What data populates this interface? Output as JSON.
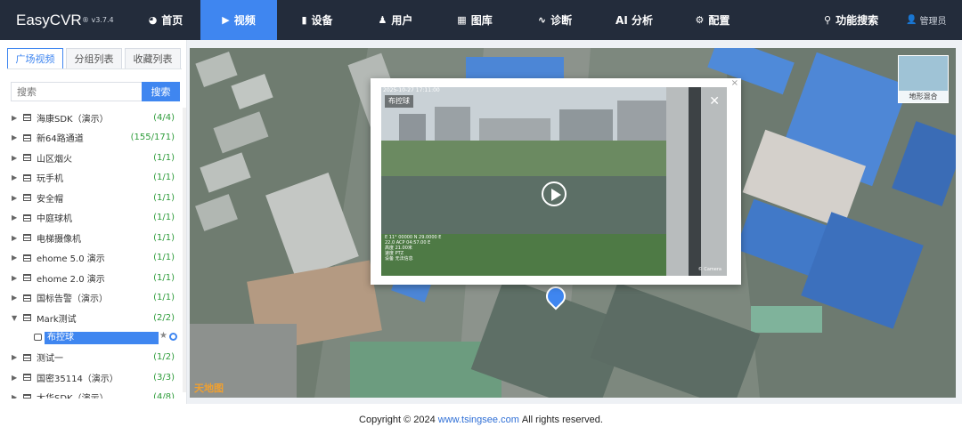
{
  "app": {
    "brand": "EasyCVR",
    "version": "v3.7.4"
  },
  "nav": {
    "items": [
      {
        "label": "首页",
        "icon": "dashboard-icon"
      },
      {
        "label": "视频",
        "icon": "play-circle-icon",
        "active": true
      },
      {
        "label": "设备",
        "icon": "device-icon"
      },
      {
        "label": "用户",
        "icon": "user-add-icon"
      },
      {
        "label": "图库",
        "icon": "gallery-icon"
      },
      {
        "label": "诊断",
        "icon": "pulse-icon"
      },
      {
        "label": "AI 分析",
        "icon": ""
      },
      {
        "label": "配置",
        "icon": "gear-icon"
      }
    ],
    "feature_search": "功能搜索",
    "user": "管理员"
  },
  "sidebar": {
    "tabs": [
      "广场视频",
      "分组列表",
      "收藏列表"
    ],
    "search_placeholder": "搜索",
    "search_button": "搜索",
    "tree": [
      {
        "label": "海康SDK（演示）",
        "count": "(4/4)",
        "expanded": false
      },
      {
        "label": "新64路通道",
        "count": "(155/171)",
        "expanded": false
      },
      {
        "label": "山区烟火",
        "count": "(1/1)",
        "expanded": false
      },
      {
        "label": "玩手机",
        "count": "(1/1)",
        "expanded": false
      },
      {
        "label": "安全帽",
        "count": "(1/1)",
        "expanded": false
      },
      {
        "label": "中庭球机",
        "count": "(1/1)",
        "expanded": false
      },
      {
        "label": "电梯摄像机",
        "count": "(1/1)",
        "expanded": false
      },
      {
        "label": "ehome 5.0 演示",
        "count": "(1/1)",
        "expanded": false
      },
      {
        "label": "ehome 2.0 演示",
        "count": "(1/1)",
        "expanded": false
      },
      {
        "label": "国标告警（演示）",
        "count": "(1/1)",
        "expanded": false
      },
      {
        "label": "Mark测试",
        "count": "(2/2)",
        "expanded": true
      },
      {
        "label": "测试一",
        "count": "(1/2)",
        "expanded": false
      },
      {
        "label": "国密35114（演示）",
        "count": "(3/3)",
        "expanded": false
      },
      {
        "label": "大华SDK（演示）",
        "count": "(4/8)",
        "expanded": false
      }
    ],
    "selected_child": "布控球"
  },
  "map": {
    "layer_label": "地形混合",
    "watermark": "天地图",
    "popup": {
      "timestamp": "2025-10-27 17:11:00",
      "channel_name": "布控球",
      "overlay_lines": [
        "E 11° 00000 N 29.0000 E",
        "22.0 ACP 04:57.00 E",
        "高度 21.00米",
        "速度 PTZ",
        "设备 无法信息"
      ],
      "brand_corner": "© Camera"
    }
  },
  "footer": {
    "prefix": "Copyright © 2024",
    "link": "www.tsingsee.com",
    "suffix": "All rights reserved."
  }
}
